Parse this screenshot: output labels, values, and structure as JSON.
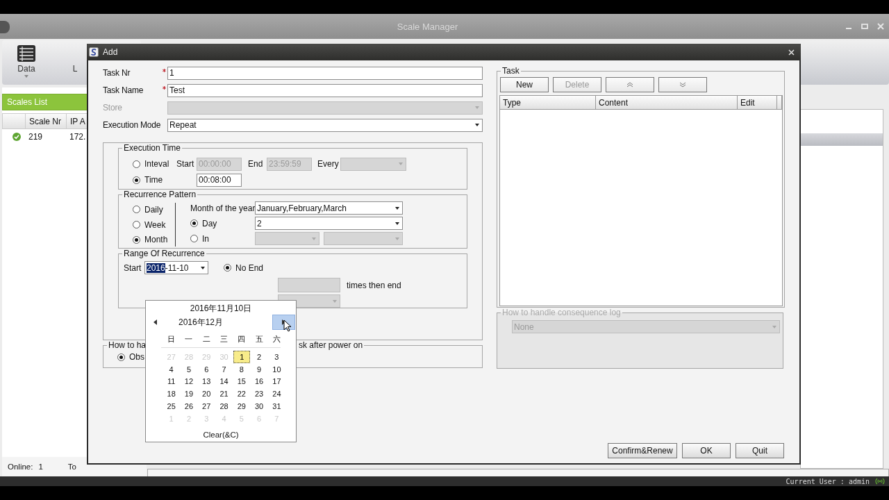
{
  "app": {
    "title": "Scale Manager",
    "toolbar": [
      {
        "label": "Data",
        "kind": "data"
      },
      {
        "label": "L",
        "kind": "other"
      }
    ],
    "scales_list": {
      "title": "Scales List",
      "columns": [
        "Scale Nr",
        "IP A"
      ],
      "rows": [
        {
          "cells": [
            "219",
            "172."
          ]
        }
      ]
    },
    "online_label": "Online:",
    "online_count": "1",
    "total_label": "To",
    "status_bar": "Current User : admin"
  },
  "dialog": {
    "title": "Add",
    "fields": [
      {
        "label": "Task Nr",
        "required": true,
        "kind": "text",
        "value": "1",
        "disabled": false
      },
      {
        "label": "Task Name",
        "required": true,
        "kind": "text",
        "value": "Test",
        "disabled": false
      },
      {
        "label": "Store",
        "required": false,
        "kind": "select",
        "disabled": true
      },
      {
        "label": "Execution Mode",
        "required": false,
        "kind": "select",
        "value": "Repeat",
        "disabled": false
      }
    ],
    "execution_time": {
      "legend": "Execution Time",
      "interval": {
        "label": "Inteval",
        "selected": false,
        "start_label": "Start",
        "start": "00:00:00",
        "end_label": "End",
        "end": "23:59:59",
        "every_label": "Every",
        "disabled": true
      },
      "time": {
        "label": "Time",
        "selected": true,
        "value": "00:08:00"
      }
    },
    "recurrence_pattern": {
      "legend": "Recurrence Pattern",
      "patterns": [
        {
          "label": "Daily",
          "selected": false
        },
        {
          "label": "Week",
          "selected": false
        },
        {
          "label": "Month",
          "selected": true
        }
      ],
      "month_of_year_label": "Month of the year",
      "month_of_year": "January,February,March",
      "day": {
        "label": "Day",
        "selected": true,
        "value": "2"
      },
      "in": {
        "label": "In",
        "selected": false
      }
    },
    "range": {
      "legend": "Range Of Recurrence",
      "start_label": "Start",
      "start_parts": [
        {
          "text": "2016",
          "selected": true
        },
        {
          "text": "-11-10",
          "selected": false
        }
      ],
      "no_end": {
        "label": "No End",
        "selected": true
      },
      "times_label": "times then end"
    },
    "power_on": {
      "legend_parts": [
        "How to ha",
        "sk after power on"
      ],
      "option": {
        "label": "Obs",
        "selected": true
      }
    },
    "task": {
      "legend": "Task",
      "buttons": [
        {
          "kind": "text",
          "label": "New",
          "disabled": false
        },
        {
          "kind": "text",
          "label": "Delete",
          "disabled": true
        },
        {
          "kind": "up"
        },
        {
          "kind": "down"
        }
      ],
      "columns": [
        "Type",
        "Content",
        "Edit"
      ]
    },
    "consequence_log": {
      "legend": "How to handle consequence log",
      "value": "None",
      "disabled": true
    },
    "buttons": [
      "Confirm&Renew",
      "OK",
      "Quit"
    ]
  },
  "calendar": {
    "today": "2016年11月10日",
    "month": "2016年12月",
    "weekdays": [
      "日",
      "一",
      "二",
      "三",
      "四",
      "五",
      "六"
    ],
    "weeks": [
      [
        {
          "day": "27",
          "other_month": true,
          "selected": false
        },
        {
          "day": "28",
          "other_month": true,
          "selected": false
        },
        {
          "day": "29",
          "other_month": true,
          "selected": false
        },
        {
          "day": "30",
          "other_month": true,
          "selected": false
        },
        {
          "day": "1",
          "other_month": false,
          "selected": true
        },
        {
          "day": "2",
          "other_month": false,
          "selected": false
        },
        {
          "day": "3",
          "other_month": false,
          "selected": false
        }
      ],
      [
        {
          "day": "4",
          "other_month": false,
          "selected": false
        },
        {
          "day": "5",
          "other_month": false,
          "selected": false
        },
        {
          "day": "6",
          "other_month": false,
          "selected": false
        },
        {
          "day": "7",
          "other_month": false,
          "selected": false
        },
        {
          "day": "8",
          "other_month": false,
          "selected": false
        },
        {
          "day": "9",
          "other_month": false,
          "selected": false
        },
        {
          "day": "10",
          "other_month": false,
          "selected": false
        }
      ],
      [
        {
          "day": "11",
          "other_month": false,
          "selected": false
        },
        {
          "day": "12",
          "other_month": false,
          "selected": false
        },
        {
          "day": "13",
          "other_month": false,
          "selected": false
        },
        {
          "day": "14",
          "other_month": false,
          "selected": false
        },
        {
          "day": "15",
          "other_month": false,
          "selected": false
        },
        {
          "day": "16",
          "other_month": false,
          "selected": false
        },
        {
          "day": "17",
          "other_month": false,
          "selected": false
        }
      ],
      [
        {
          "day": "18",
          "other_month": false,
          "selected": false
        },
        {
          "day": "19",
          "other_month": false,
          "selected": false
        },
        {
          "day": "20",
          "other_month": false,
          "selected": false
        },
        {
          "day": "21",
          "other_month": false,
          "selected": false
        },
        {
          "day": "22",
          "other_month": false,
          "selected": false
        },
        {
          "day": "23",
          "other_month": false,
          "selected": false
        },
        {
          "day": "24",
          "other_month": false,
          "selected": false
        }
      ],
      [
        {
          "day": "25",
          "other_month": false,
          "selected": false
        },
        {
          "day": "26",
          "other_month": false,
          "selected": false
        },
        {
          "day": "27",
          "other_month": false,
          "selected": false
        },
        {
          "day": "28",
          "other_month": false,
          "selected": false
        },
        {
          "day": "29",
          "other_month": false,
          "selected": false
        },
        {
          "day": "30",
          "other_month": false,
          "selected": false
        },
        {
          "day": "31",
          "other_month": false,
          "selected": false
        }
      ],
      [
        {
          "day": "1",
          "other_month": true,
          "selected": false
        },
        {
          "day": "2",
          "other_month": true,
          "selected": false
        },
        {
          "day": "3",
          "other_month": true,
          "selected": false
        },
        {
          "day": "4",
          "other_month": true,
          "selected": false
        },
        {
          "day": "5",
          "other_month": true,
          "selected": false
        },
        {
          "day": "6",
          "other_month": true,
          "selected": false
        },
        {
          "day": "7",
          "other_month": true,
          "selected": false
        }
      ]
    ],
    "clear": "Clear(&C)"
  }
}
